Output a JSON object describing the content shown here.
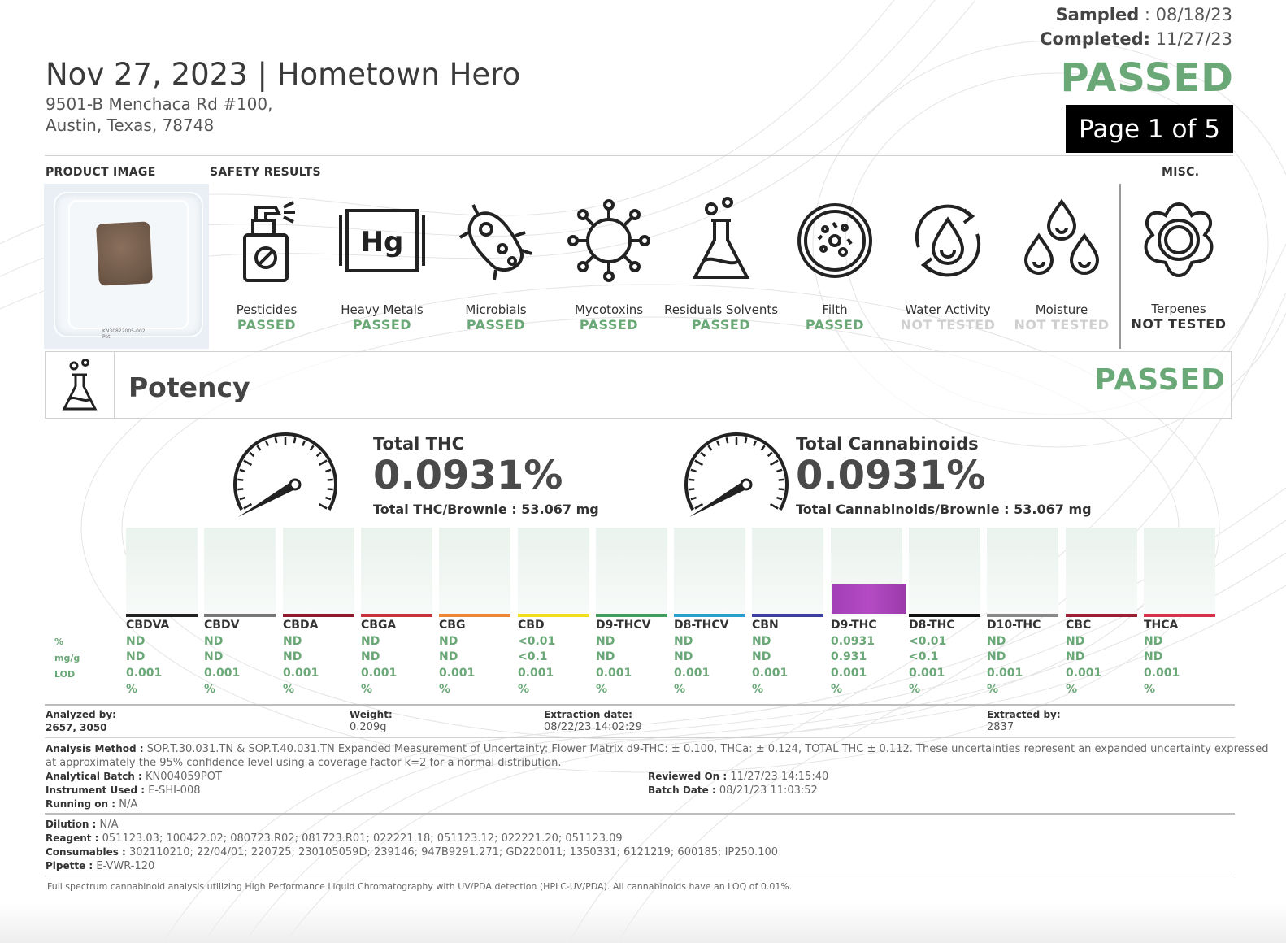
{
  "header": {
    "title": "Nov 27, 2023 | Hometown Hero",
    "address_line1": "9501-B Menchaca Rd #100,",
    "address_line2": "Austin, Texas, 78748",
    "sampled_label": "Sampled",
    "sampled_value": " : 08/18/23",
    "completed_label": "Completed:",
    "completed_value": " 11/27/23",
    "status": "PASSED",
    "page_indicator": "Page 1 of 5"
  },
  "labels": {
    "product_image": "PRODUCT IMAGE",
    "safety_results": "SAFETY RESULTS",
    "misc": "MISC.",
    "image_caption_1": "KN30822005-002",
    "image_caption_2": "Pot"
  },
  "safety": [
    {
      "name": "Pesticides",
      "status": "PASSED",
      "icon": "spray-bottle-icon"
    },
    {
      "name": "Heavy Metals",
      "status": "PASSED",
      "icon": "mercury-icon"
    },
    {
      "name": "Microbials",
      "status": "PASSED",
      "icon": "bacteria-icon"
    },
    {
      "name": "Mycotoxins",
      "status": "PASSED",
      "icon": "virus-icon"
    },
    {
      "name": "Residuals Solvents",
      "status": "PASSED",
      "icon": "flask-icon"
    },
    {
      "name": "Filth",
      "status": "PASSED",
      "icon": "petri-dish-icon"
    },
    {
      "name": "Water Activity",
      "status": "NOT TESTED",
      "icon": "water-cycle-icon"
    },
    {
      "name": "Moisture",
      "status": "NOT TESTED",
      "icon": "droplets-icon"
    }
  ],
  "misc": [
    {
      "name": "Terpenes",
      "status": "NOT TESTED",
      "icon": "flower-icon"
    }
  ],
  "colors": {
    "passed": "#6aa877",
    "not_tested_safety": "#cfcfcf",
    "not_tested_misc": "#333333",
    "d9_bar": "#b44bc4"
  },
  "potency": {
    "title": "Potency",
    "status": "PASSED",
    "total_thc": {
      "title": "Total THC",
      "value": "0.0931%",
      "sub": "Total THC/Brownie : 53.067 mg",
      "gauge_level": 0.0931
    },
    "total_cannabinoids": {
      "title": "Total Cannabinoids",
      "value": "0.0931%",
      "sub": "Total Cannabinoids/Brownie : 53.067 mg",
      "gauge_level": 0.0931
    },
    "row_labels": [
      "%",
      "mg/g",
      "LOD"
    ],
    "lod_unit": "%",
    "cannabinoids": [
      {
        "name": "CBDVA",
        "pct": "ND",
        "mgg": "ND",
        "lod": "0.001",
        "color": "#222222",
        "bar_value": 0
      },
      {
        "name": "CBDV",
        "pct": "ND",
        "mgg": "ND",
        "lod": "0.001",
        "color": "#777777",
        "bar_value": 0
      },
      {
        "name": "CBDA",
        "pct": "ND",
        "mgg": "ND",
        "lod": "0.001",
        "color": "#8b1a2b",
        "bar_value": 0
      },
      {
        "name": "CBGA",
        "pct": "ND",
        "mgg": "ND",
        "lod": "0.001",
        "color": "#c8323d",
        "bar_value": 0
      },
      {
        "name": "CBG",
        "pct": "ND",
        "mgg": "ND",
        "lod": "0.001",
        "color": "#e8873a",
        "bar_value": 0
      },
      {
        "name": "CBD",
        "pct": "<0.01",
        "mgg": "<0.1",
        "lod": "0.001",
        "color": "#f1de1f",
        "bar_value": 0
      },
      {
        "name": "D9-THCV",
        "pct": "ND",
        "mgg": "ND",
        "lod": "0.001",
        "color": "#3f9f5c",
        "bar_value": 0
      },
      {
        "name": "D8-THCV",
        "pct": "ND",
        "mgg": "ND",
        "lod": "0.001",
        "color": "#2a9fd0",
        "bar_value": 0
      },
      {
        "name": "CBN",
        "pct": "ND",
        "mgg": "ND",
        "lod": "0.001",
        "color": "#3b3fa0",
        "bar_value": 0
      },
      {
        "name": "D9-THC",
        "pct": "0.0931",
        "mgg": "0.931",
        "lod": "0.001",
        "color": "#b44bc4",
        "bar_value": 0.0931
      },
      {
        "name": "D8-THC",
        "pct": "<0.01",
        "mgg": "<0.1",
        "lod": "0.001",
        "color": "#111111",
        "bar_value": 0
      },
      {
        "name": "D10-THC",
        "pct": "ND",
        "mgg": "ND",
        "lod": "0.001",
        "color": "#888888",
        "bar_value": 0
      },
      {
        "name": "CBC",
        "pct": "ND",
        "mgg": "ND",
        "lod": "0.001",
        "color": "#9b1f32",
        "bar_value": 0
      },
      {
        "name": "THCA",
        "pct": "ND",
        "mgg": "ND",
        "lod": "0.001",
        "color": "#d8324a",
        "bar_value": 0
      }
    ]
  },
  "meta": {
    "analyzed_by_label": "Analyzed by:",
    "analyzed_by": "2657, 3050",
    "weight_label": "Weight:",
    "weight": "0.209g",
    "extraction_date_label": "Extraction date:",
    "extraction_date": "08/22/23 14:02:29",
    "extracted_by_label": "Extracted by:",
    "extracted_by": "2837"
  },
  "analysis": {
    "method_label": "Analysis Method : ",
    "method_line1": "SOP.T.30.031.TN & SOP.T.40.031.TN Expanded Measurement of Uncertainty: Flower Matrix d9-THC: ± 0.100, THCa: ± 0.124, TOTAL THC ± 0.112. These uncertainties represent an expanded uncertainty expressed",
    "method_line2": "at approximately the 95% confidence level using a coverage factor k=2 for a normal distribution.",
    "batch_label": "Analytical Batch : ",
    "batch": "KN004059POT",
    "instrument_label": "Instrument Used : ",
    "instrument": "E-SHI-008",
    "running_label": "Running on : ",
    "running": "N/A",
    "reviewed_label": "Reviewed On : ",
    "reviewed": "11/27/23 14:15:40",
    "batch_date_label": "Batch Date : ",
    "batch_date": "08/21/23 11:03:52"
  },
  "prep": {
    "dilution_label": "Dilution : ",
    "dilution": "N/A",
    "reagent_label": "Reagent : ",
    "reagent": "051123.03; 100422.02; 080723.R02; 081723.R01; 022221.18; 051123.12; 022221.20; 051123.09",
    "consumables_label": "Consumables : ",
    "consumables": "302110210; 22/04/01; 220725; 230105059D; 239146; 947B9291.271; GD220011; 1350331; 6121219; 600185; IP250.100",
    "pipette_label": "Pipette : ",
    "pipette": "E-VWR-120"
  },
  "footnote": "Full spectrum cannabinoid analysis utilizing High Performance Liquid Chromatography with UV/PDA detection (HPLC-UV/PDA). All cannabinoids have an LOQ of 0.01%."
}
